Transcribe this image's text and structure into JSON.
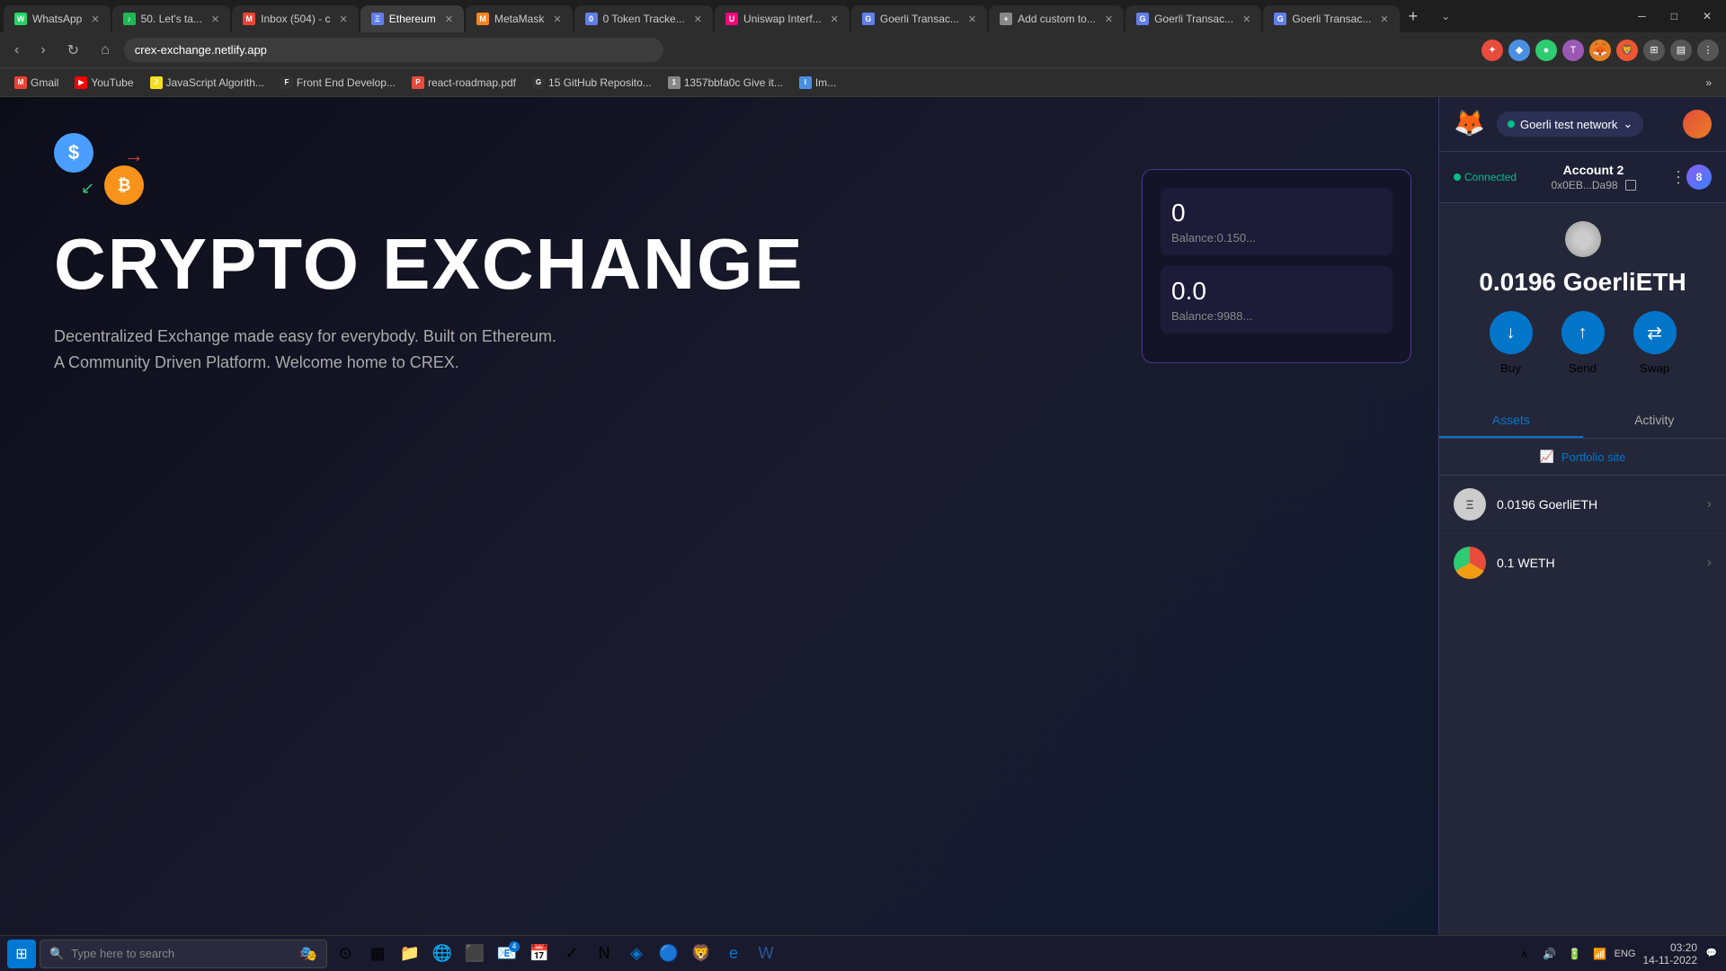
{
  "browser": {
    "tabs": [
      {
        "id": "whatsapp",
        "label": "WhatsApp",
        "favicon_color": "#25D366",
        "favicon_char": "W",
        "active": false
      },
      {
        "id": "music",
        "label": "50. Let's ta...",
        "favicon_color": "#1DB954",
        "favicon_char": "♪",
        "active": false
      },
      {
        "id": "gmail",
        "label": "Inbox (504) - c",
        "favicon_color": "#EA4335",
        "favicon_char": "M",
        "active": false
      },
      {
        "id": "ethereum",
        "label": "Ethereum",
        "favicon_color": "#627EEA",
        "favicon_char": "Ξ",
        "active": true
      },
      {
        "id": "metamask",
        "label": "MetaMask",
        "favicon_color": "#F5841F",
        "favicon_char": "M",
        "active": false
      },
      {
        "id": "token-tracker",
        "label": "0 Token Tracke...",
        "favicon_color": "#627EEA",
        "favicon_char": "0",
        "active": false
      },
      {
        "id": "uniswap",
        "label": "Uniswap Interf...",
        "favicon_color": "#FF007A",
        "favicon_char": "U",
        "active": false
      },
      {
        "id": "goerli-tx1",
        "label": "Goerli Transac...",
        "favicon_color": "#627EEA",
        "favicon_char": "G",
        "active": false
      },
      {
        "id": "add-custom",
        "label": "Add custom to...",
        "favicon_color": "#888",
        "favicon_char": "+",
        "active": false
      },
      {
        "id": "goerli-tx2",
        "label": "Goerli Transac...",
        "favicon_color": "#627EEA",
        "favicon_char": "G",
        "active": false
      },
      {
        "id": "goerli-tx3",
        "label": "Goerli Transac...",
        "favicon_color": "#627EEA",
        "favicon_char": "G",
        "active": false
      }
    ],
    "url": "crex-exchange.netlify.app",
    "back_enabled": false,
    "forward_enabled": false
  },
  "bookmarks": [
    {
      "label": "Gmail",
      "favicon_color": "#EA4335",
      "char": "M"
    },
    {
      "label": "YouTube",
      "favicon_color": "#FF0000",
      "char": "▶"
    },
    {
      "label": "JavaScript Algorith...",
      "favicon_color": "#F7DF1E",
      "char": "J"
    },
    {
      "label": "Front End Develop...",
      "favicon_color": "#333",
      "char": "F"
    },
    {
      "label": "react-roadmap.pdf",
      "favicon_color": "#e74c3c",
      "char": "P"
    },
    {
      "label": "15 GitHub Reposito...",
      "favicon_color": "#333",
      "char": "G"
    },
    {
      "label": "1357bbfa0c Give it...",
      "favicon_color": "#888",
      "char": "1"
    },
    {
      "label": "Im...",
      "favicon_color": "#4a90e2",
      "char": "I"
    }
  ],
  "metamask": {
    "network": "Goerli test network",
    "network_dot_color": "#00c087",
    "account_name": "Account 2",
    "account_address": "0x0EB...Da98",
    "connected_label": "Connected",
    "balance": "0.0196 GoerliETH",
    "actions": {
      "buy": "Buy",
      "send": "Send",
      "swap": "Swap"
    },
    "tabs": {
      "assets": "Assets",
      "activity": "Activity"
    },
    "portfolio_link": "Portfolio site",
    "assets": [
      {
        "name": "0.0196 GoerliETH",
        "icon_type": "eth"
      },
      {
        "name": "0.1 WETH",
        "icon_type": "weth"
      }
    ]
  },
  "website": {
    "title": "CRYPTO EXCHANGE",
    "subtitle": "Decentralized Exchange made easy for everybody. Built on Ethereum. A Community Driven Platform. Welcome home to CREX.",
    "widget": {
      "value1": "0",
      "balance1": "Balance:0.150...",
      "value2": "0.0",
      "balance2": "Balance:9988..."
    }
  },
  "taskbar": {
    "search_placeholder": "Type here to search",
    "time": "03:20",
    "date": "14-11-2022",
    "language": "ENG",
    "notification_count": "4"
  }
}
